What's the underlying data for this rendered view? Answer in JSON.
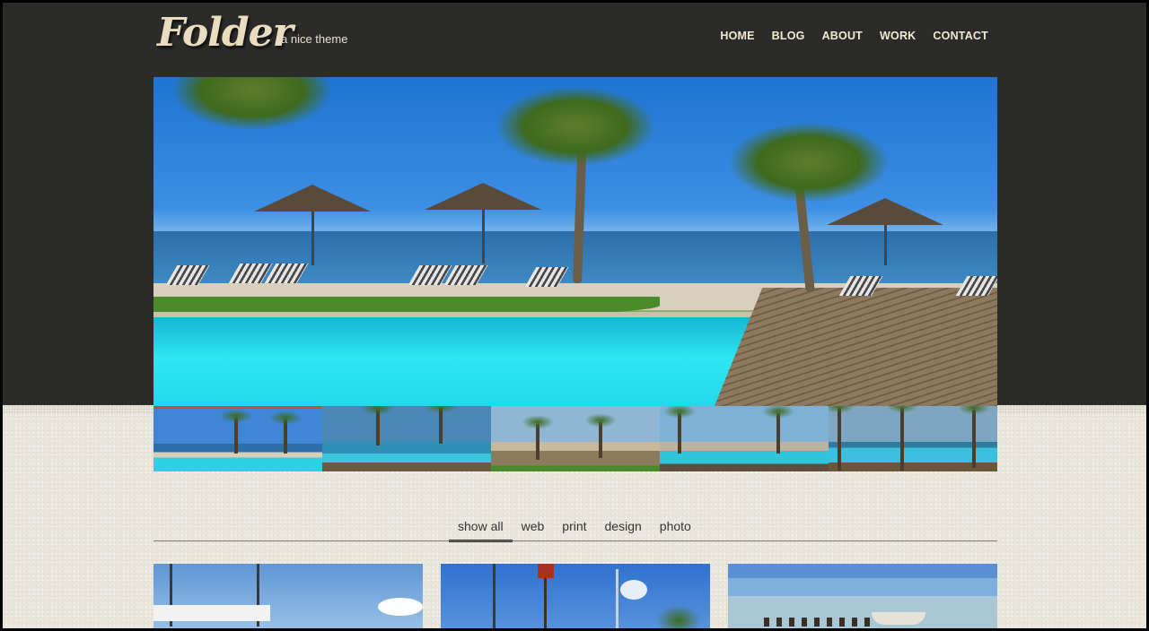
{
  "header": {
    "logo": "Folder",
    "tagline": "a nice theme",
    "nav": [
      "HOME",
      "BLOG",
      "ABOUT",
      "WORK",
      "CONTACT"
    ]
  },
  "filters": [
    "show all",
    "web",
    "print",
    "design",
    "photo"
  ],
  "active_filter": "show all",
  "colors": {
    "header_bg": "#2b2b2a",
    "page_bg": "#ebe6dd",
    "accent": "#c0503a",
    "logo": "#e9dcbf"
  }
}
